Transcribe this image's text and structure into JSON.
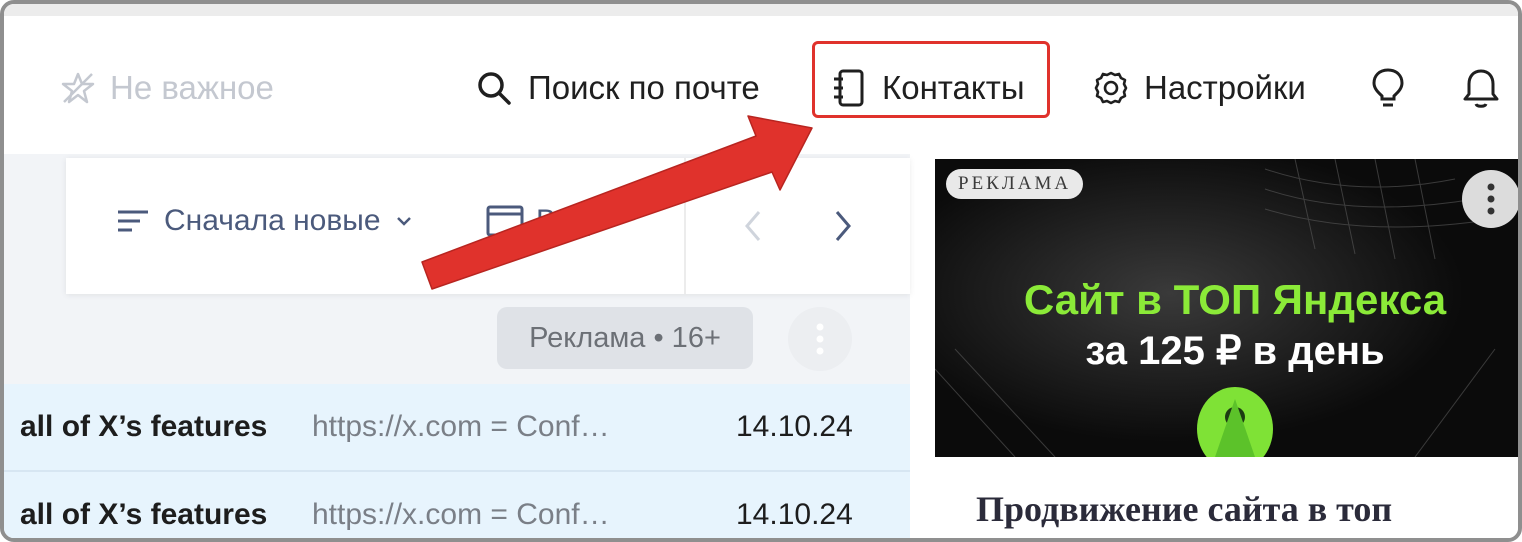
{
  "header": {
    "not_important_label": "Не важное",
    "search_label": "Поиск по почте",
    "contacts_label": "Контакты",
    "settings_label": "Настройки"
  },
  "toolbar": {
    "sort_label": "Сначала новые",
    "view_label": "Вид"
  },
  "ad_row": {
    "label": "Реклама • 16+"
  },
  "emails": [
    {
      "subject": "all of X’s features",
      "snippet": "https://x.com = Conf…",
      "date": "14.10.24"
    },
    {
      "subject": "all of X’s features",
      "snippet": "https://x.com = Conf…",
      "date": "14.10.24"
    }
  ],
  "ad_banner": {
    "badge": "РЕКЛАМА",
    "headline_line1": "Сайт в ТОП Яндекса",
    "headline_line2": "за 125 ₽ в день",
    "title": "Продвижение сайта в топ"
  },
  "colors": {
    "highlight": "#e0322c",
    "accent_green": "#8bea38",
    "unread_row_bg": "#e7f4fd"
  },
  "icons": [
    "star-slash-icon",
    "search-icon",
    "contacts-book-icon",
    "gear-icon",
    "lightbulb-icon",
    "bell-icon",
    "sort-lines-icon",
    "chevron-down-icon",
    "view-window-icon",
    "chevron-left-icon",
    "chevron-right-icon",
    "more-vertical-icon",
    "rocket-icon"
  ]
}
